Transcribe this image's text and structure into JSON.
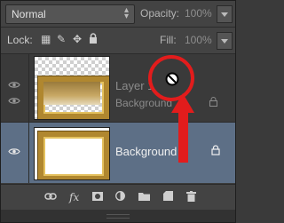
{
  "header": {
    "blend_mode": "Normal",
    "opacity_label": "Opacity:",
    "opacity_value": "100%",
    "lock_label": "Lock:",
    "fill_label": "Fill:",
    "fill_value": "100%"
  },
  "layers": [
    {
      "name": "Layer 1",
      "secondary": "Background",
      "visible": true,
      "selected": false
    },
    {
      "name": "Background",
      "visible": true,
      "selected": true,
      "locked": true
    }
  ],
  "bottom_icons": [
    "link-icon",
    "fx-icon",
    "mask-icon",
    "adjustment-icon",
    "folder-icon",
    "new-layer-icon",
    "trash-icon"
  ],
  "annotation_color": "#e21c1c",
  "selection_color": "#5d6f86"
}
